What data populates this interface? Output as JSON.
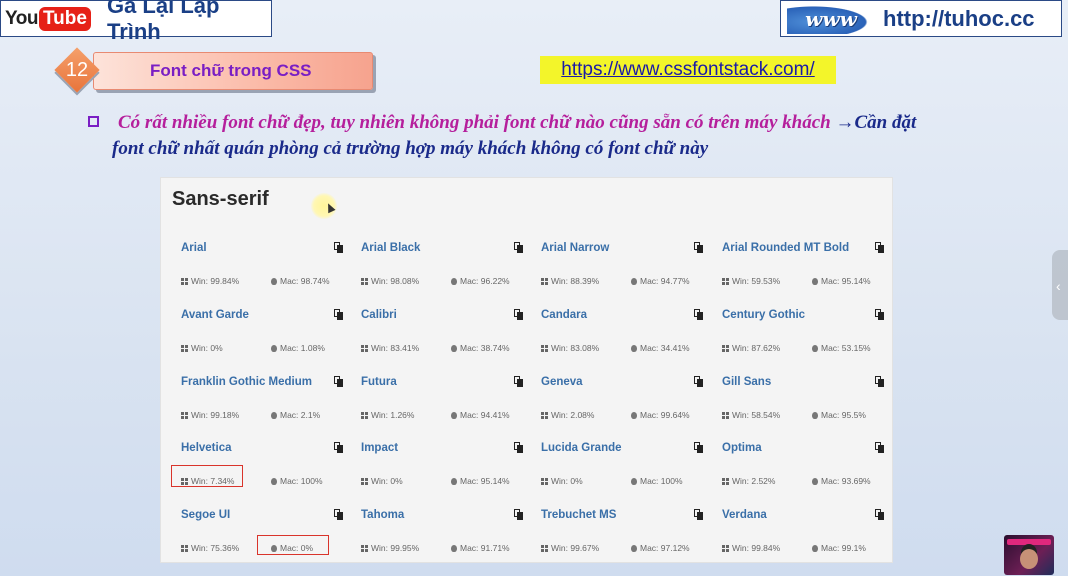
{
  "header": {
    "yt_you": "You",
    "yt_tube": "Tube",
    "channel_name": "Gà Lại Lập Trình",
    "www_logo_text": "www",
    "site_url": "http://tuhoc.cc"
  },
  "lesson": {
    "number": "12",
    "title": "Font chữ trong CSS"
  },
  "link": {
    "url": "https://www.cssfontstack.com/"
  },
  "bullet": {
    "line1_part1": "Có rất nhiều font chữ đẹp, tuy nhiên không phải font chữ nào cũng sẵn có trên máy khách",
    "arrow": "→",
    "line1_part2": "Cần đặt",
    "line2": "font chữ nhất quán phòng cả trường hợp máy khách không có font chữ này"
  },
  "screenshot": {
    "title": "Sans-serif",
    "fonts": [
      {
        "name": "Arial",
        "win": "Win: 99.84%",
        "mac": "Mac: 98.74%"
      },
      {
        "name": "Arial Black",
        "win": "Win: 98.08%",
        "mac": "Mac: 96.22%"
      },
      {
        "name": "Arial Narrow",
        "win": "Win: 88.39%",
        "mac": "Mac: 94.77%"
      },
      {
        "name": "Arial Rounded MT Bold",
        "win": "Win: 59.53%",
        "mac": "Mac: 95.14%"
      },
      {
        "name": "Avant Garde",
        "win": "Win: 0%",
        "mac": "Mac: 1.08%"
      },
      {
        "name": "Calibri",
        "win": "Win: 83.41%",
        "mac": "Mac: 38.74%"
      },
      {
        "name": "Candara",
        "win": "Win: 83.08%",
        "mac": "Mac: 34.41%"
      },
      {
        "name": "Century Gothic",
        "win": "Win: 87.62%",
        "mac": "Mac: 53.15%"
      },
      {
        "name": "Franklin Gothic Medium",
        "win": "Win: 99.18%",
        "mac": "Mac: 2.1%"
      },
      {
        "name": "Futura",
        "win": "Win: 1.26%",
        "mac": "Mac: 94.41%"
      },
      {
        "name": "Geneva",
        "win": "Win: 2.08%",
        "mac": "Mac: 99.64%"
      },
      {
        "name": "Gill Sans",
        "win": "Win: 58.54%",
        "mac": "Mac: 95.5%"
      },
      {
        "name": "Helvetica",
        "win": "Win: 7.34%",
        "mac": "Mac: 100%"
      },
      {
        "name": "Impact",
        "win": "Win: 0%",
        "mac": "Mac: 95.14%"
      },
      {
        "name": "Lucida Grande",
        "win": "Win: 0%",
        "mac": "Mac: 100%"
      },
      {
        "name": "Optima",
        "win": "Win: 2.52%",
        "mac": "Mac: 93.69%"
      },
      {
        "name": "Segoe UI",
        "win": "Win: 75.36%",
        "mac": "Mac: 0%"
      },
      {
        "name": "Tahoma",
        "win": "Win: 99.95%",
        "mac": "Mac: 91.71%"
      },
      {
        "name": "Trebuchet MS",
        "win": "Win: 99.67%",
        "mac": "Mac: 97.12%"
      },
      {
        "name": "Verdana",
        "win": "Win: 99.84%",
        "mac": "Mac: 99.1%"
      }
    ]
  },
  "colors": {
    "channel_blue": "#1a3f86",
    "lesson_title_purple": "#7a1ec4",
    "bullet_magenta": "#b51f9c",
    "font_link_blue": "#3a6fa8",
    "highlight_red": "#d9342b",
    "link_bg_yellow": "#f3f52a"
  }
}
